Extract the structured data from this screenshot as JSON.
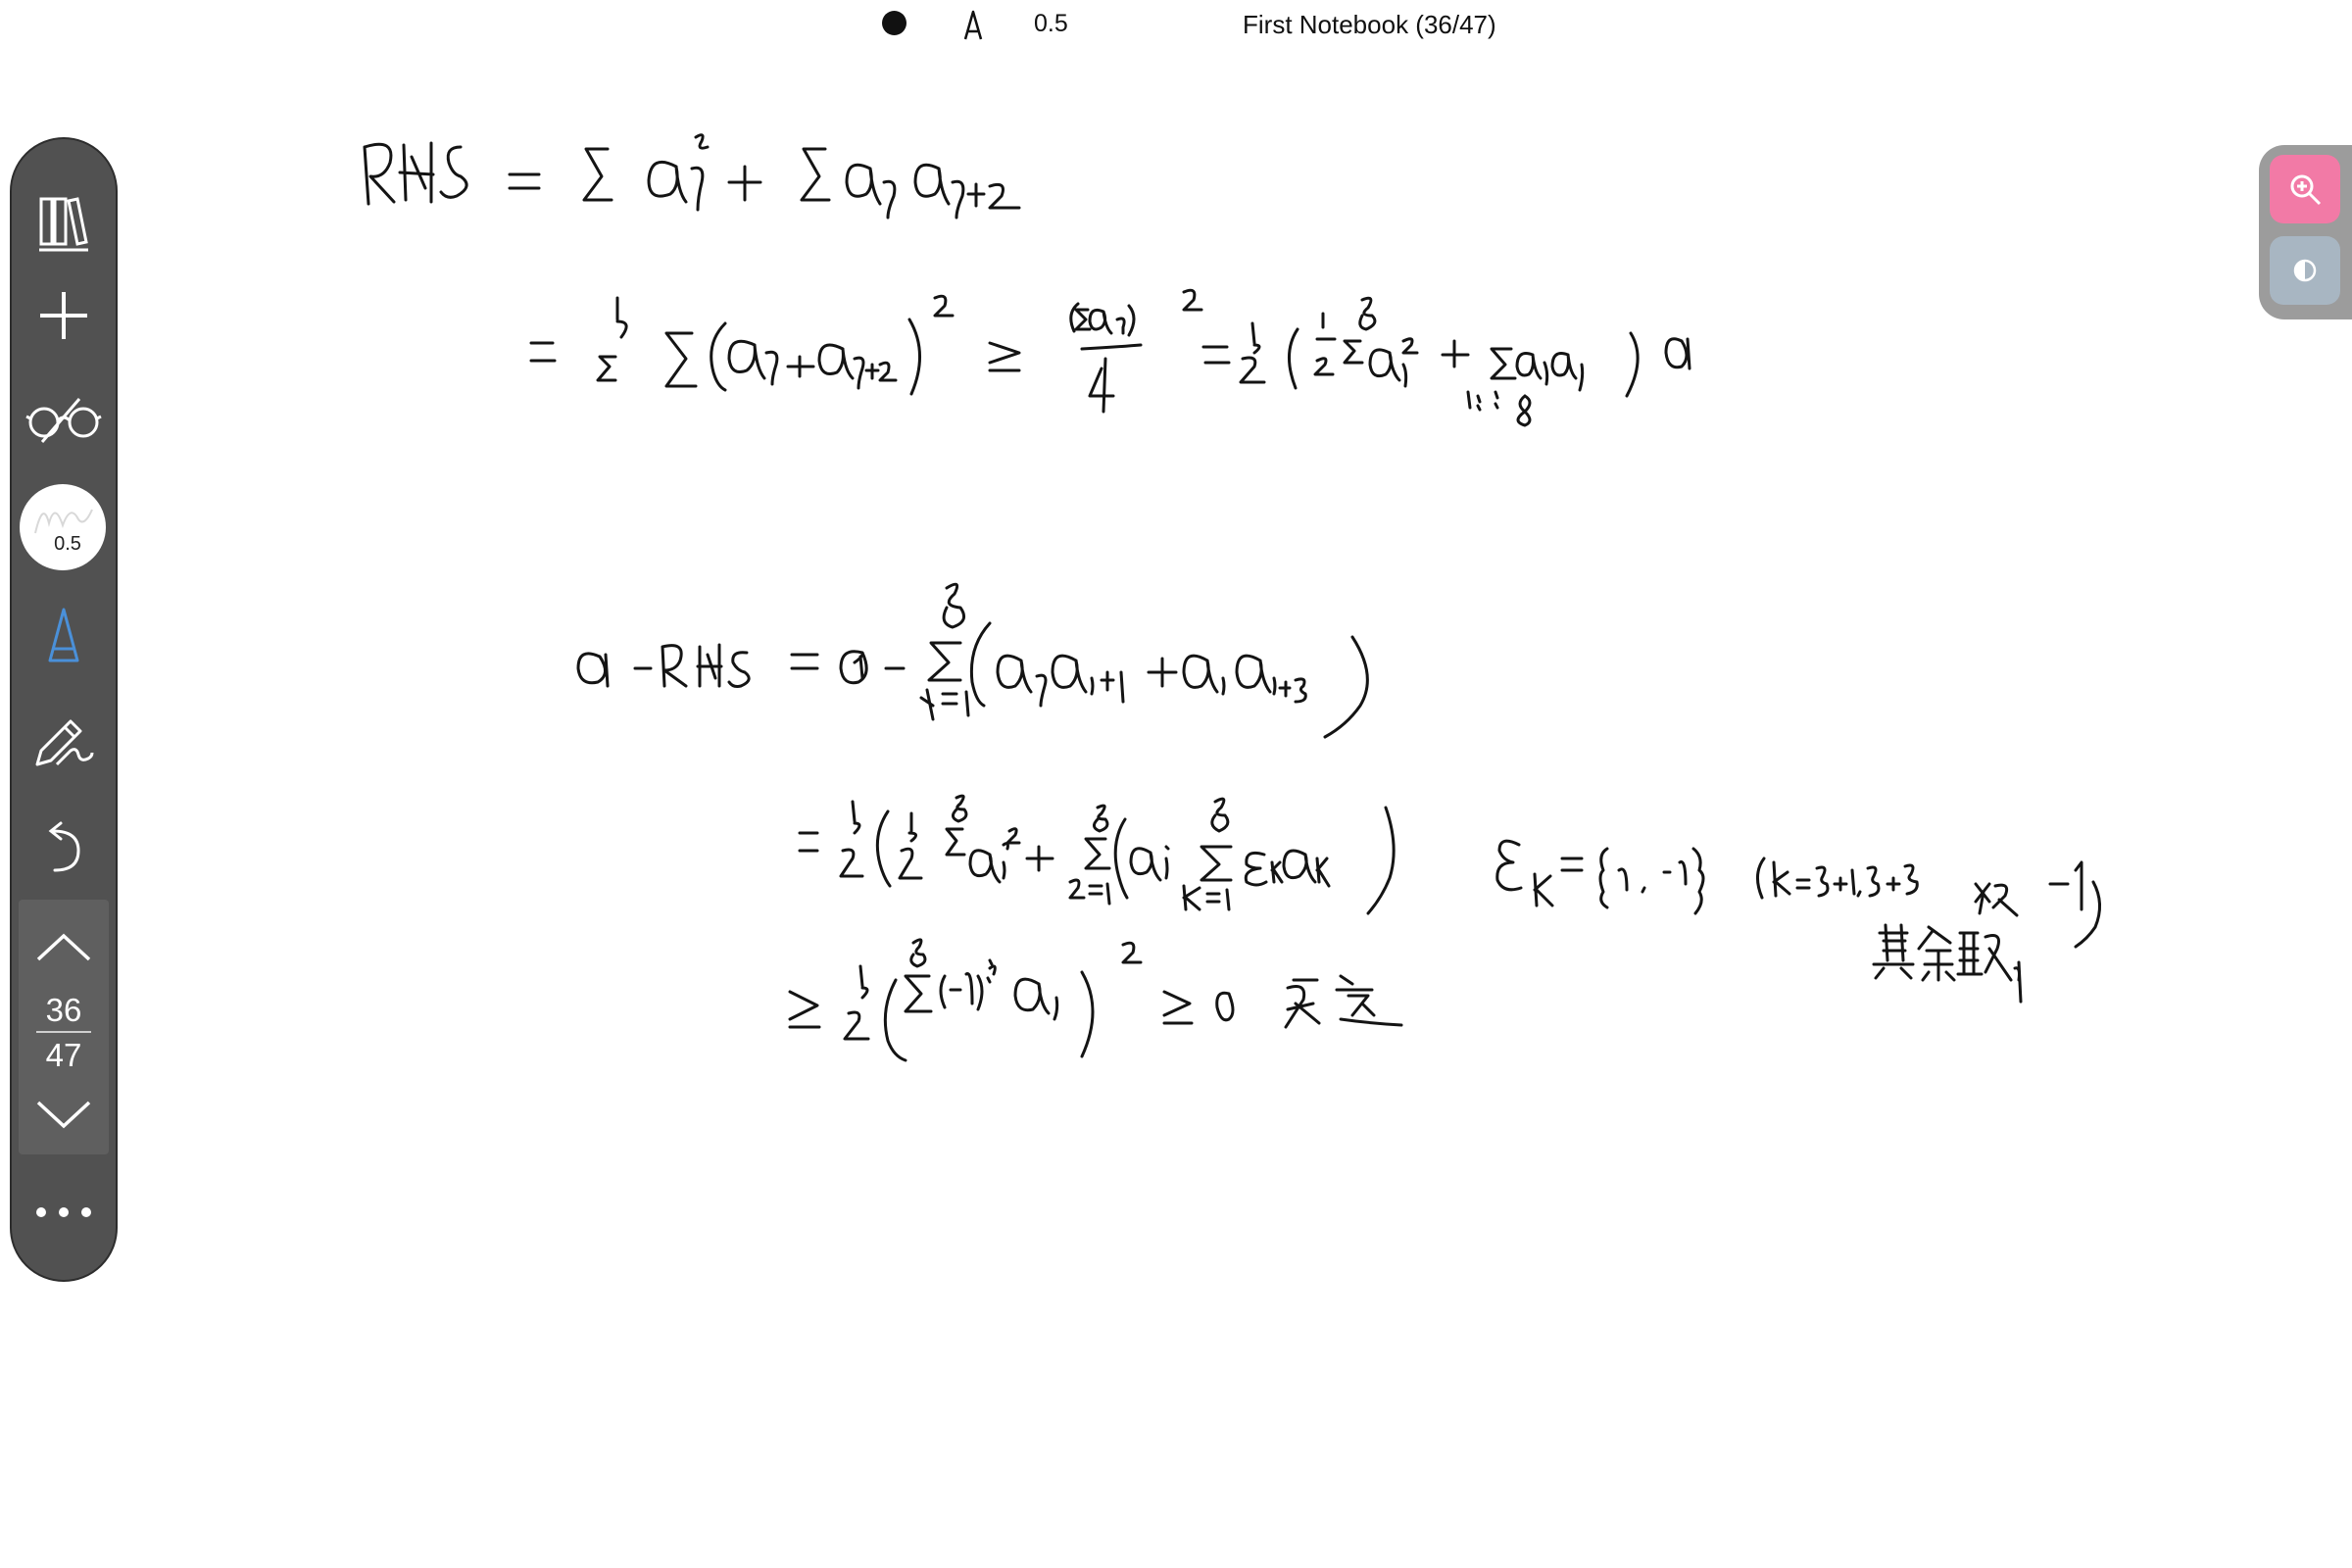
{
  "topbar": {
    "pen_size": "0.5",
    "notebook_title": "First Notebook (36/47)"
  },
  "toolbar": {
    "pen_preview_size": "0.5",
    "page_current": "36",
    "page_total": "47",
    "icons": [
      "library-icon",
      "add-icon",
      "glasses-icon",
      "pen-preview",
      "pen-tip-icon",
      "pencil-icon",
      "undo-icon",
      "page-up-icon",
      "page-down-icon",
      "more-icon"
    ]
  },
  "right_panel": {
    "icons": [
      "zoom-in-icon",
      "contrast-icon"
    ]
  },
  "colors": {
    "toolbar_bg": "#515151",
    "zoom_button": "#f27aa6",
    "contrast_button": "#a8b6c2",
    "pen_tip_accent": "#4a90d9"
  }
}
